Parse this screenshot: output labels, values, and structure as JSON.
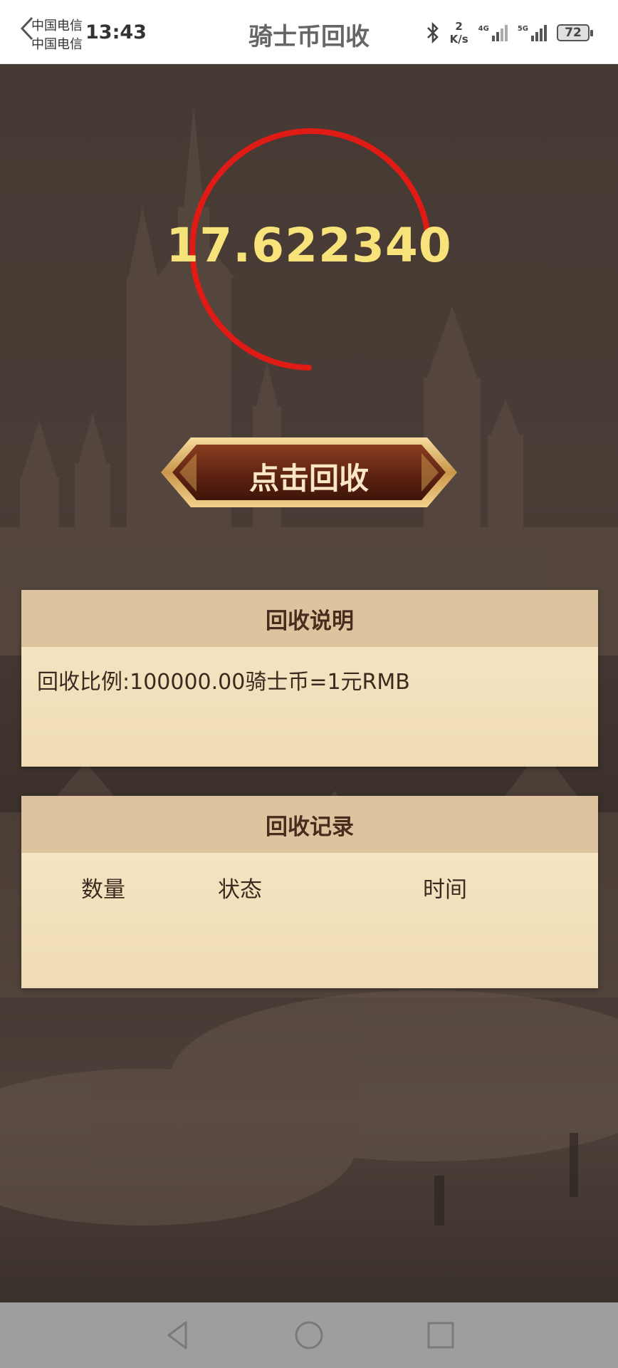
{
  "status_bar": {
    "carrier_1": "中国电信",
    "carrier_2": "中国电信",
    "time": "13:43",
    "net_speed_value": "2",
    "net_speed_unit": "K/s",
    "sim1_tag": "4G",
    "sim2_tag": "5G",
    "battery": "72",
    "icons": [
      "back-chevron-icon",
      "bluetooth-icon",
      "signal-icon",
      "battery-icon"
    ]
  },
  "header": {
    "title": "骑士币回收"
  },
  "counter": {
    "value": "17.622340",
    "ring_color": "#e01a14",
    "value_color": "#f7e37a"
  },
  "action": {
    "recover_label": "点击回收"
  },
  "info_panel": {
    "title": "回收说明",
    "text": "回收比例:100000.00骑士币=1元RMB"
  },
  "record_panel": {
    "title": "回收记录",
    "columns": [
      "数量",
      "状态",
      "时间"
    ],
    "rows": []
  },
  "navbar": {
    "icons": [
      "nav-back-icon",
      "nav-home-icon",
      "nav-recents-icon"
    ]
  }
}
